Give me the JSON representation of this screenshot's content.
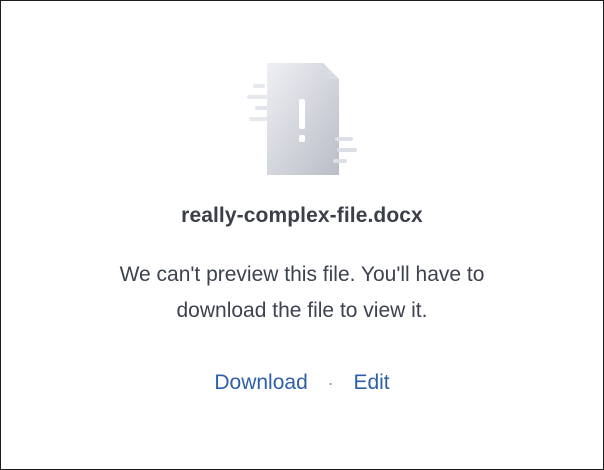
{
  "file": {
    "name": "really-complex-file.docx",
    "icon": "file-warning-icon"
  },
  "message": {
    "line1": "We can't preview this file. You'll have to",
    "line2": "download the file to view it."
  },
  "actions": {
    "download_label": "Download",
    "separator": "·",
    "edit_label": "Edit"
  },
  "colors": {
    "link": "#2f5fa8",
    "title": "#3b3f4a",
    "text": "#3d4250"
  }
}
